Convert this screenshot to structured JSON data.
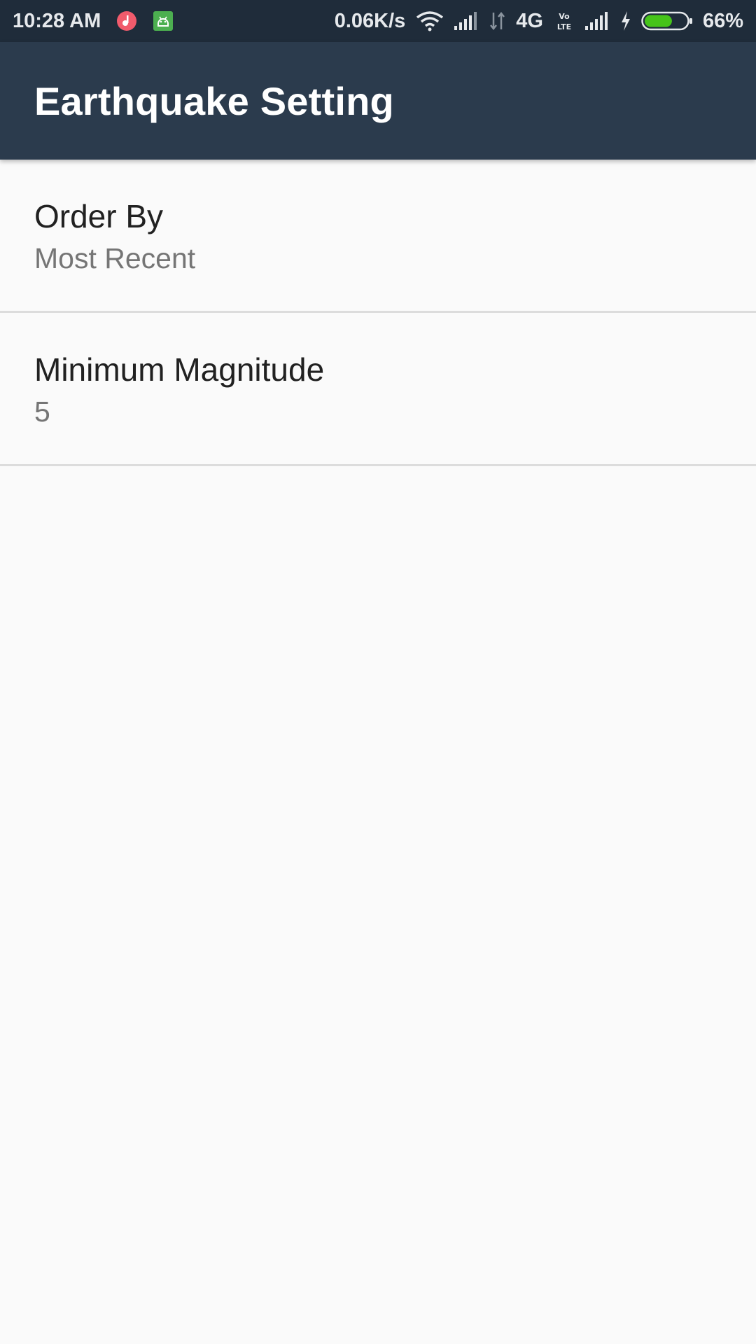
{
  "status_bar": {
    "time": "10:28 AM",
    "net_speed": "0.06K/s",
    "network_type": "4G",
    "volte": "Vo LTE",
    "battery_percent": "66%",
    "battery_level": 0.66,
    "icons": [
      "music-notification-icon",
      "android-notification-icon",
      "wifi-icon",
      "signal-icon",
      "data-arrows-icon",
      "volte-icon",
      "signal-icon",
      "charging-icon",
      "battery-icon"
    ],
    "colors": {
      "background": "#1f2c3a",
      "battery_fill": "#46c41a",
      "music_icon": "#f15b6c",
      "android_icon": "#4caf50"
    }
  },
  "app_bar": {
    "title": "Earthquake Setting",
    "color": "#2b3b4d"
  },
  "preferences": [
    {
      "title": "Order By",
      "summary": "Most Recent"
    },
    {
      "title": "Minimum Magnitude",
      "summary": "5"
    }
  ]
}
